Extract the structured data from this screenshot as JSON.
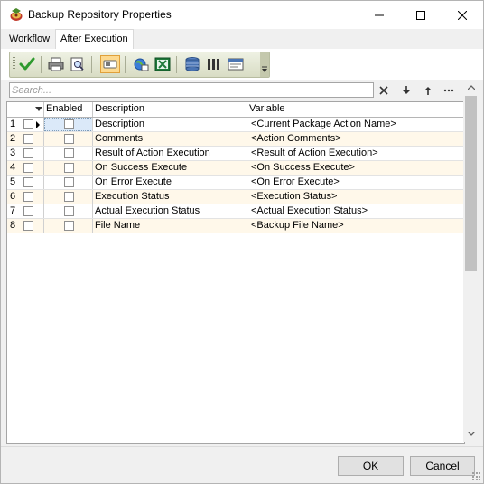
{
  "window": {
    "title": "Backup Repository Properties"
  },
  "tabs": [
    {
      "label": "Workflow"
    },
    {
      "label": "After Execution",
      "selected": true
    }
  ],
  "toolbar": {
    "icons": [
      "check-icon",
      "print-icon",
      "print-preview-icon",
      "toggle-icon",
      "web-icon",
      "excel-icon",
      "database-icon",
      "columns-icon",
      "layout-icon",
      "overflow-icon"
    ]
  },
  "search": {
    "placeholder": "Search...",
    "value": ""
  },
  "grid": {
    "columns": {
      "enabled": "Enabled",
      "description": "Description",
      "variable": "Variable"
    },
    "rows": [
      {
        "num": "1",
        "description": "Description",
        "variable": "<Current Package Action Name>"
      },
      {
        "num": "2",
        "description": "Comments",
        "variable": "<Action Comments>"
      },
      {
        "num": "3",
        "description": "Result of Action Execution",
        "variable": "<Result of Action Execution>"
      },
      {
        "num": "4",
        "description": "On Success Execute",
        "variable": "<On Success Execute>"
      },
      {
        "num": "5",
        "description": "On Error Execute",
        "variable": "<On Error Execute>"
      },
      {
        "num": "6",
        "description": "Execution Status",
        "variable": "<Execution Status>"
      },
      {
        "num": "7",
        "description": "Actual Execution Status",
        "variable": "<Actual Execution Status>"
      },
      {
        "num": "8",
        "description": "File Name",
        "variable": "<Backup File Name>"
      }
    ]
  },
  "buttons": {
    "ok": "OK",
    "cancel": "Cancel"
  }
}
